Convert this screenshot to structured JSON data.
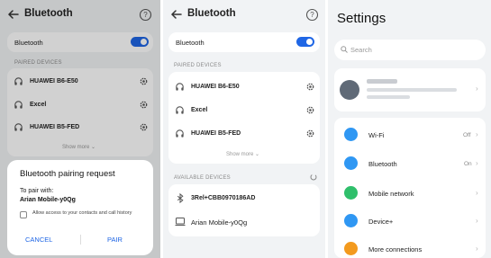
{
  "screen1": {
    "title": "Bluetooth",
    "bluetooth_label": "Bluetooth",
    "bluetooth_on": true,
    "paired_header": "PAIRED DEVICES",
    "paired_devices": [
      "HUAWEI B6-E50",
      "Excel",
      "HUAWEI B5-FED"
    ],
    "show_more": "Show more",
    "dialog": {
      "title": "Bluetooth pairing request",
      "to_pair_with": "To pair with:",
      "device": "Arian Mobile-y0Qg",
      "checkbox_label": "Allow access to your contacts and call history",
      "cancel": "CANCEL",
      "pair": "PAIR"
    }
  },
  "screen2": {
    "title": "Bluetooth",
    "bluetooth_label": "Bluetooth",
    "bluetooth_on": true,
    "paired_header": "PAIRED DEVICES",
    "paired_devices": [
      "HUAWEI B6-E50",
      "Excel",
      "HUAWEI B5-FED"
    ],
    "show_more": "Show more",
    "available_header": "AVAILABLE DEVICES",
    "available_devices": [
      "3Rel+CBB0970186AD",
      "Arian Mobile-y0Qg"
    ]
  },
  "screen3": {
    "title": "Settings",
    "search_placeholder": "Search",
    "items": [
      {
        "label": "Wi-Fi",
        "value": "Off",
        "icon": "wifi-icon",
        "color": "#2f97f3"
      },
      {
        "label": "Bluetooth",
        "value": "On",
        "icon": "bluetooth-icon",
        "color": "#2f97f3"
      },
      {
        "label": "Mobile network",
        "value": "",
        "icon": "mobile-network-icon",
        "color": "#2fbf6b"
      },
      {
        "label": "Device+",
        "value": "",
        "icon": "device-plus-icon",
        "color": "#2f97f3"
      },
      {
        "label": "More connections",
        "value": "",
        "icon": "more-connections-icon",
        "color": "#f39a1e"
      }
    ]
  },
  "colors": {
    "accent": "#1f66e5",
    "background": "#f1f3f5"
  }
}
